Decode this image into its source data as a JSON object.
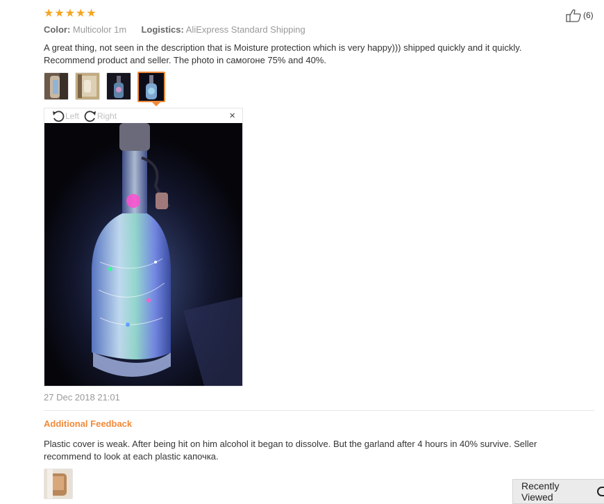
{
  "review": {
    "rating": 5,
    "likes": "(6)",
    "color_label": "Color:",
    "color_value": "Multicolor 1m",
    "logistics_label": "Logistics:",
    "logistics_value": "AliExpress Standard Shipping",
    "text_line1": "A great thing, not seen in the description that is Moisture protection which is very happy))) shipped quickly and it quickly.",
    "text_line2": "Recommend product and seller. The photo in самогоне 75% and 40%.",
    "photo_count": 4,
    "active_photo": 4,
    "viewer": {
      "rotate_left": "Left",
      "rotate_right": "Right",
      "close": "×"
    },
    "date": "27 Dec 2018 21:01"
  },
  "additional_feedback": {
    "title": "Additional Feedback",
    "text_line1": "Plastic cover is weak. After being hit on him alcohol it began to dissolve. But the garland after 4 hours in 40% survive. Seller",
    "text_line2": "recommend to look at each plastic капочка."
  },
  "recently_viewed": {
    "label": "Recently Viewed"
  },
  "icons": {
    "star": "star-icon",
    "like": "thumbs-up-icon",
    "rotate_left": "rotate-left-icon",
    "rotate_right": "rotate-right-icon",
    "close": "close-icon"
  },
  "colors": {
    "accent": "#f08a3a",
    "star": "#f5a623",
    "muted": "#999999"
  }
}
